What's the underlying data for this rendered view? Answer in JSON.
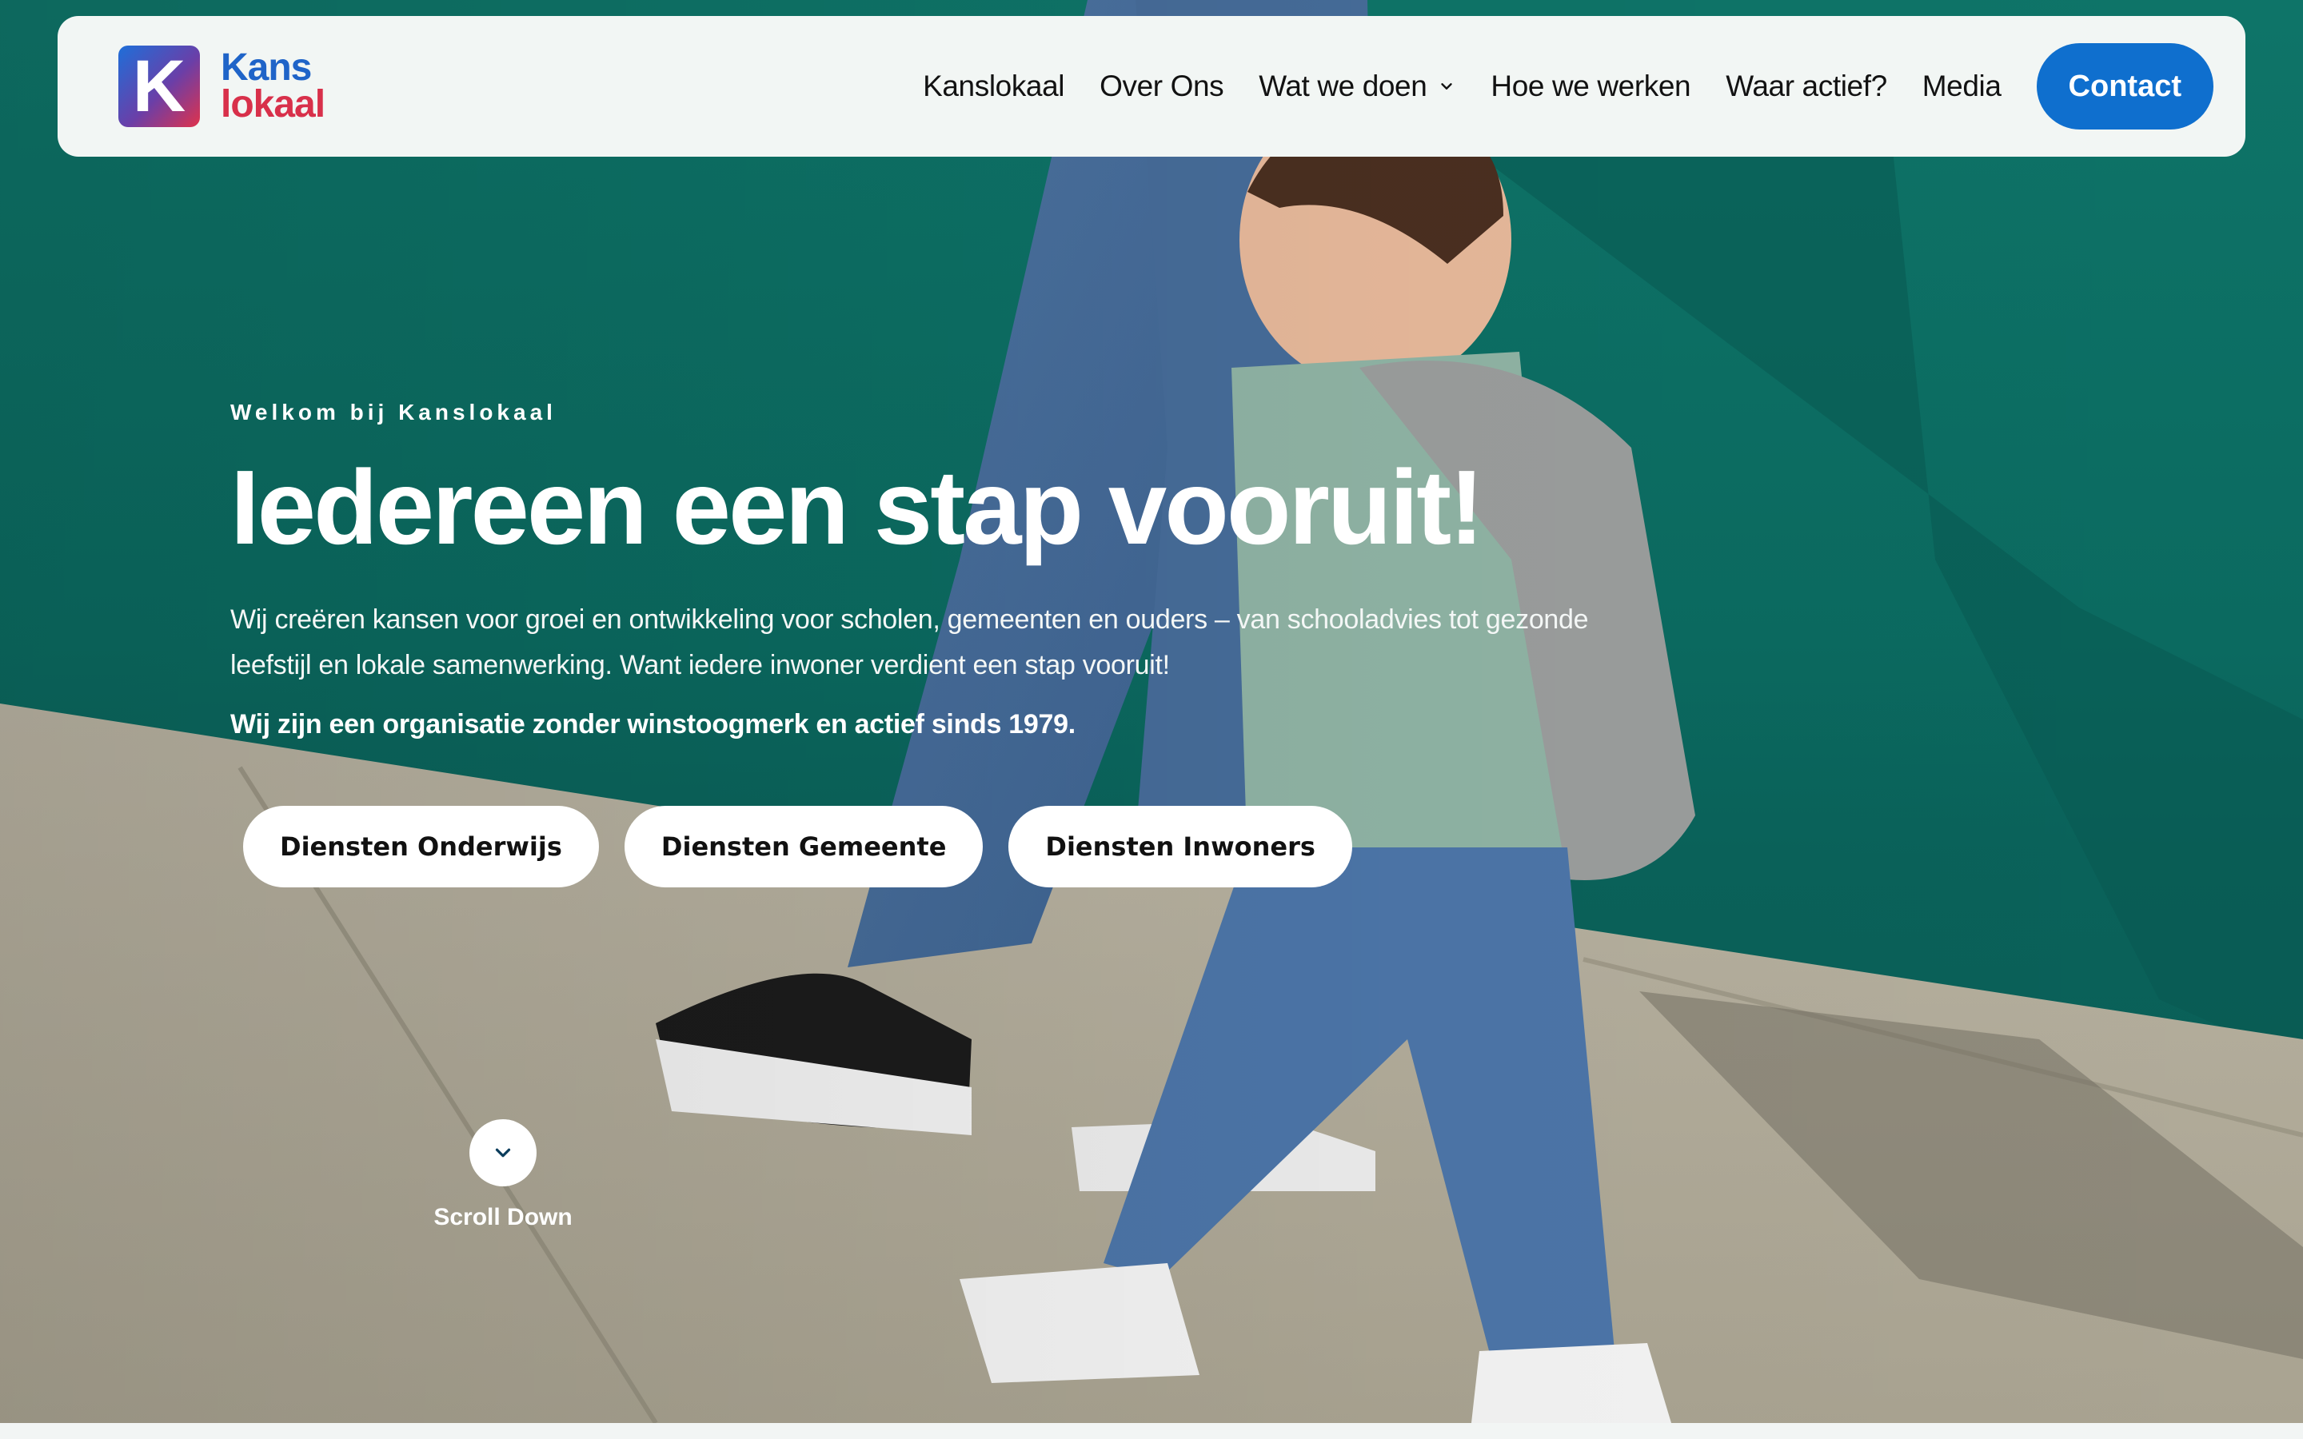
{
  "header": {
    "logo": {
      "mark": "K",
      "line1": "Kans",
      "line2": "lokaal"
    },
    "nav": [
      {
        "label": "Kanslokaal"
      },
      {
        "label": "Over Ons"
      },
      {
        "label": "Wat we doen",
        "has_dropdown": true
      },
      {
        "label": "Hoe we werken"
      },
      {
        "label": "Waar actief?"
      },
      {
        "label": "Media"
      }
    ],
    "contact_label": "Contact"
  },
  "hero": {
    "eyebrow": "Welkom bij Kanslokaal",
    "title": "Iedereen een stap vooruit!",
    "intro": "Wij creëren kansen voor groei en ontwikkeling voor scholen, gemeenten en ouders – van schooladvies tot gezonde leefstijl en lokale samenwerking. Want iedere inwoner verdient een stap vooruit!",
    "tagline": "Wij zijn een organisatie zonder winstoogmerk en actief sinds 1979.",
    "buttons": [
      {
        "label": "Diensten Onderwijs"
      },
      {
        "label": "Diensten Gemeente"
      },
      {
        "label": "Diensten Inwoners"
      }
    ],
    "scroll_label": "Scroll Down"
  },
  "icons": {
    "nav_dropdown": "chevron-down-icon",
    "scroll": "chevron-down-icon"
  },
  "colors": {
    "header_bg": "#f2f6f4",
    "contact_button": "#0f6fce",
    "logo_blue": "#1f64c8",
    "logo_red": "#d8304a",
    "hero_wall": "#0e7468",
    "hero_pavement": "#b9b3a2"
  }
}
